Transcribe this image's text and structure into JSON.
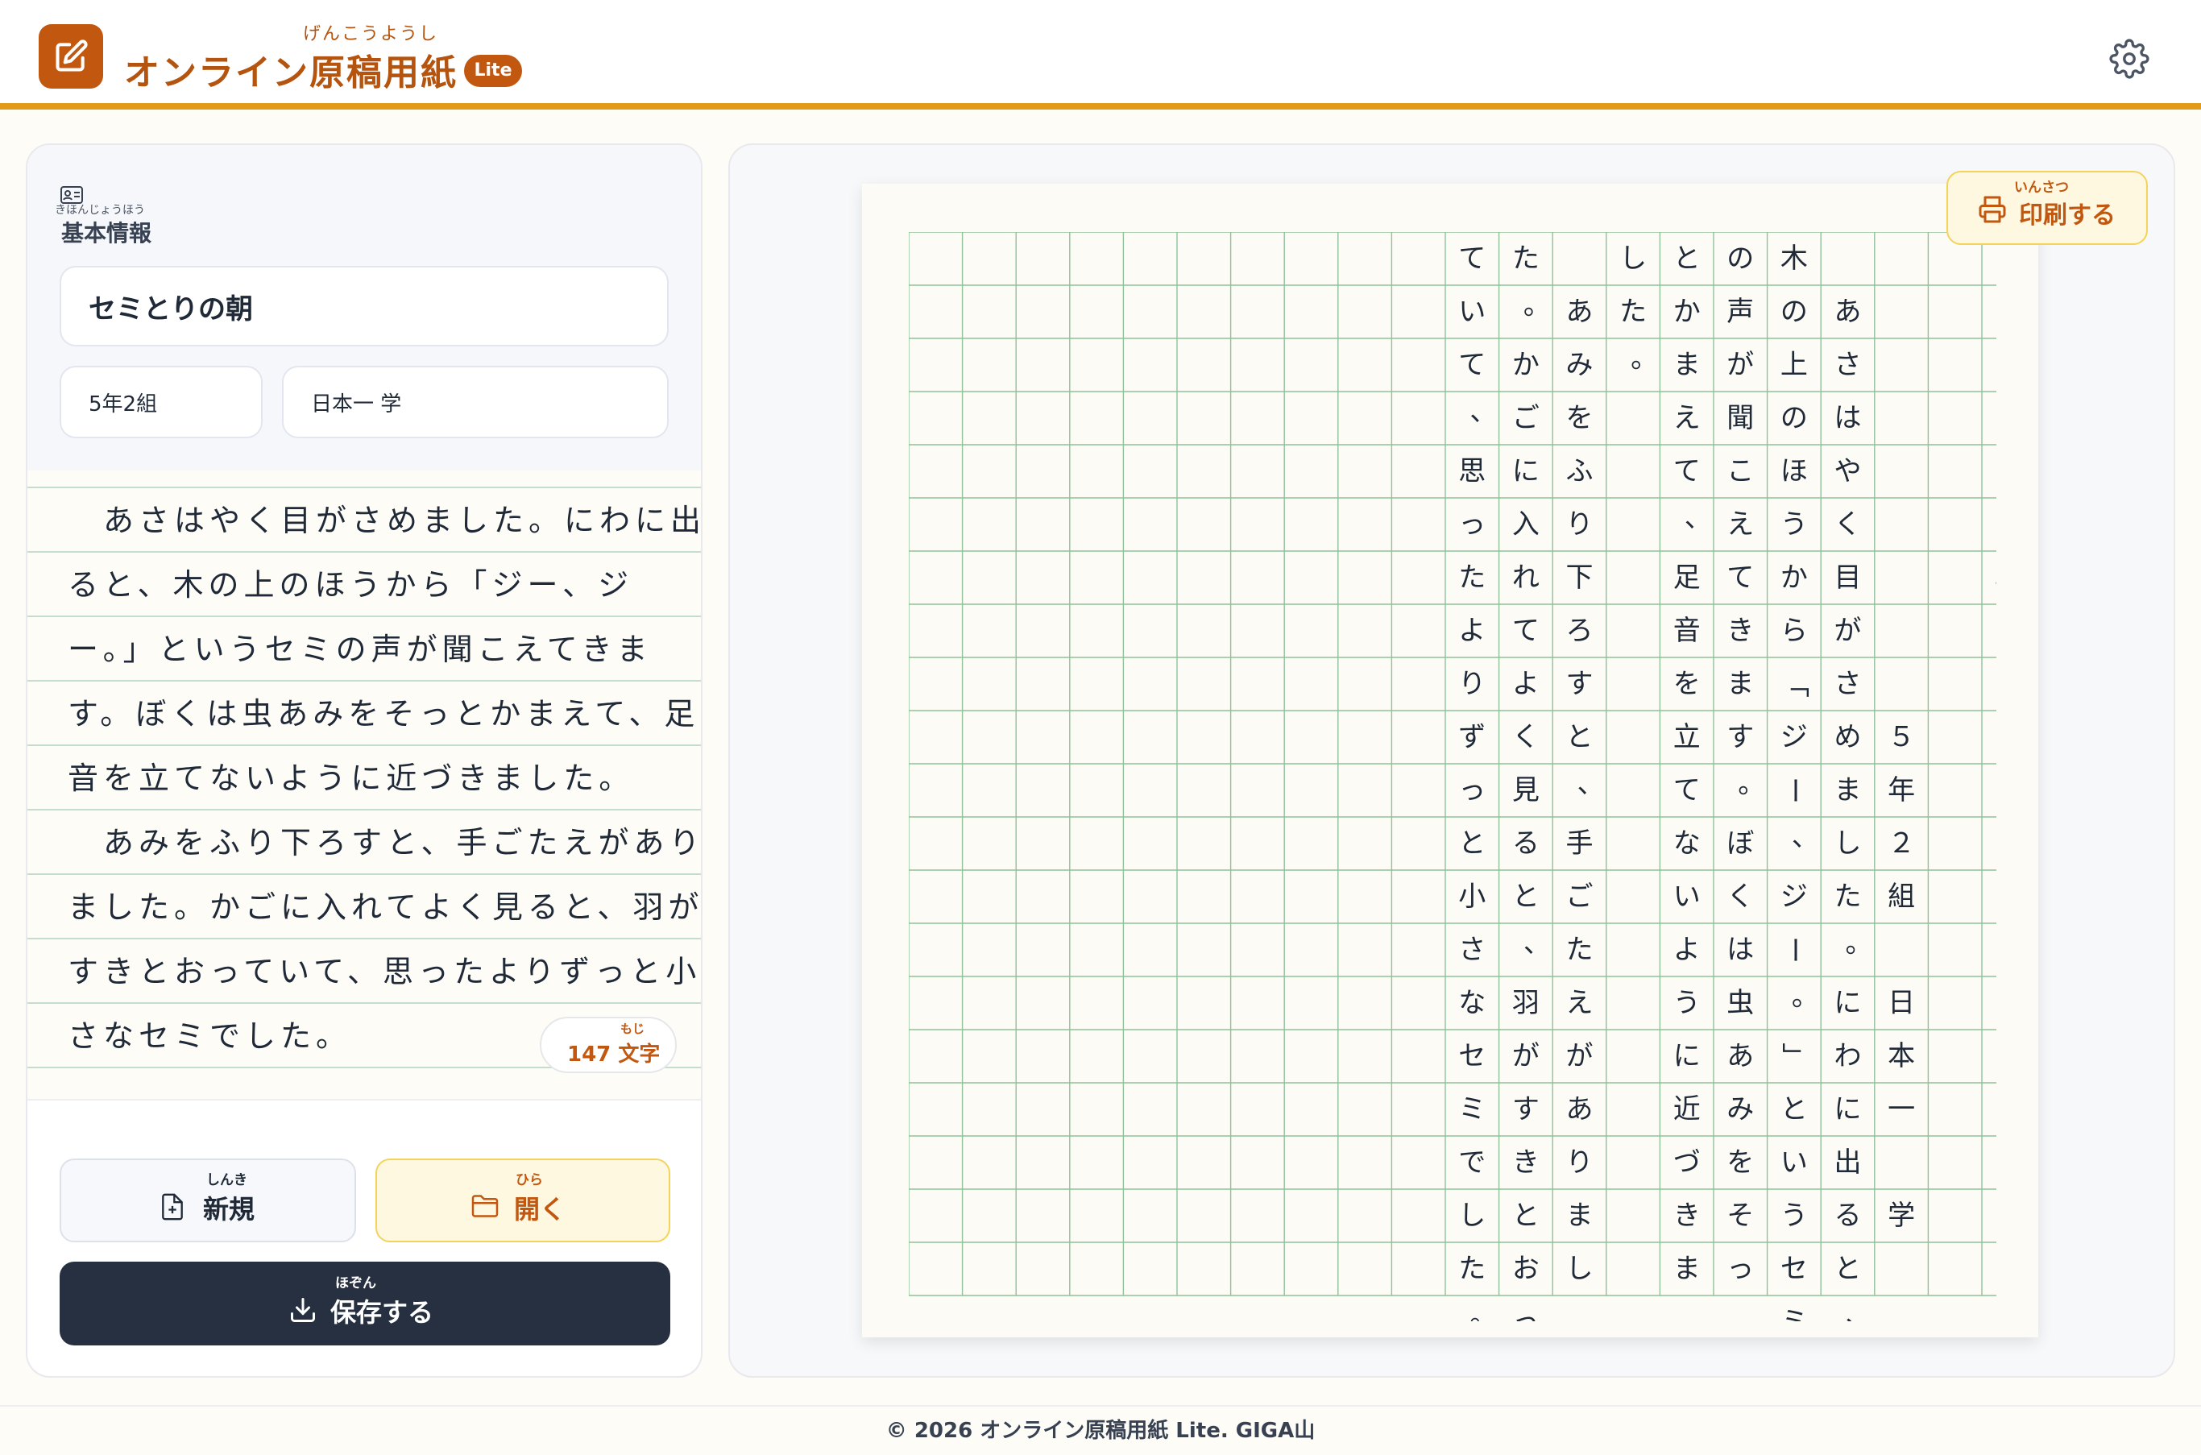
{
  "header": {
    "title": "オンライン原稿用紙",
    "title_ruby": "げんこうようし",
    "badge": "Lite"
  },
  "sidebar": {
    "info_label": "基本情報",
    "info_ruby": "きほんじょうほう",
    "title_value": "セミとりの朝",
    "class_value": "5年2組",
    "name_value": "日本一 学",
    "body_lines": [
      "　あさはやく目がさめました。にわに出",
      "ると、木の上のほうから「ジー、ジ",
      "ー。」というセミの声が聞こえてきま",
      "す。ぼくは虫あみをそっとかまえて、足",
      "音を立てないように近づきました。",
      "　あみをふり下ろすと、手ごたえがあり",
      "ました。かごに入れてよく見ると、羽が",
      "すきとおっていて、思ったよりずっと小",
      "さなセミでした。"
    ],
    "char_count": "147",
    "char_unit": "文字",
    "char_ruby": "もじ"
  },
  "buttons": {
    "new_label": "新規",
    "new_ruby": "しんき",
    "open_label": "開く",
    "open_ruby": "ひら",
    "save_label": "保存する",
    "save_ruby": "ほぞん",
    "print_label": "印刷する",
    "print_ruby": "いんさつ"
  },
  "manuscript": {
    "columns": [
      "　セミとりの朝",
      "",
      "　　　　　　　　　５年２組　日本一　学",
      "　あさはやく目がさめました。にわに出ると、",
      "木の上のほうから「ジー、ジー。」というセミ",
      "の声が聞こえてきます。ぼくは虫あみをそっ",
      "とかまえて、足音を立てないように近づきま",
      "した。",
      "　あみをふり下ろすと、手ごたえがありまし",
      "た。かごに入れてよく見ると、羽がすきとおっ",
      "ていて、思ったよりずっと小さなセミでした。",
      "",
      "",
      "",
      "",
      "",
      "",
      "",
      "",
      "",
      ""
    ]
  },
  "footer": {
    "text": "© 2026 オンライン原稿用紙 Lite. GIGA山"
  },
  "colors": {
    "accent": "#c2570f",
    "header_rule": "#e39b17",
    "grid_line": "#8fc19a",
    "dark_button": "#263041"
  }
}
